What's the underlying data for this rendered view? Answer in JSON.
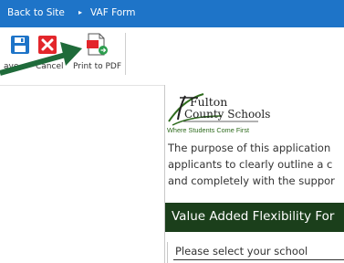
{
  "breadcrumb": {
    "back_label": "Back to Site",
    "separator": "▸",
    "current_label": "VAF Form"
  },
  "toolbar": {
    "save_label": "Save",
    "save_label_visible": "ave",
    "cancel_label": "Cancel",
    "print_label": "Print to PDF",
    "icons": [
      "save-icon",
      "cancel-icon",
      "print-pdf-icon"
    ]
  },
  "document": {
    "logo": {
      "line1": "Fulton",
      "line2": "County Schools",
      "tagline": "Where Students Come First"
    },
    "intro_lines": [
      "The purpose of this application",
      "applicants to clearly outline a c",
      "and completely with the suppor"
    ],
    "form_title": "Value Added Flexibility For",
    "school_select": {
      "placeholder": "Please select your school"
    }
  },
  "colors": {
    "topbar": "#1e74c8",
    "form_banner": "#1b3f1b",
    "arrow": "#1f6b3a",
    "cancel_red": "#e3262b",
    "save_blue": "#1e74c8"
  }
}
